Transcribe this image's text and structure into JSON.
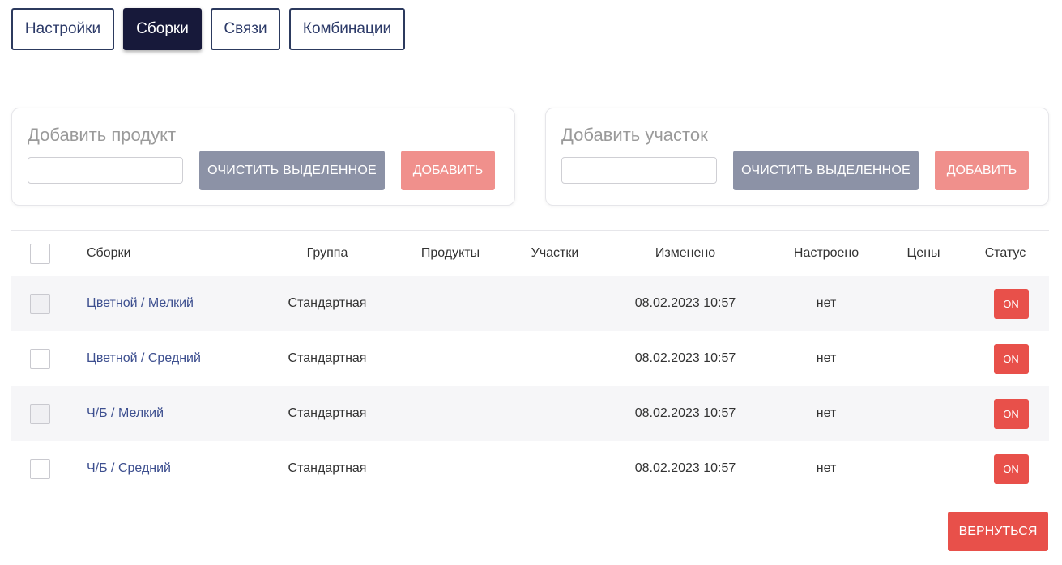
{
  "tabs": {
    "settings": "Настройки",
    "assemblies": "Сборки",
    "links": "Связи",
    "combinations": "Комбинации"
  },
  "add_product": {
    "title": "Добавить продукт",
    "input_value": "",
    "clear_label": "ОЧИСТИТЬ ВЫДЕЛЕННОЕ",
    "add_label": "ДОБАВИТЬ"
  },
  "add_area": {
    "title": "Добавить участок",
    "input_value": "",
    "clear_label": "ОЧИСТИТЬ ВЫДЕЛЕННОЕ",
    "add_label": "ДОБАВИТЬ"
  },
  "table": {
    "columns": [
      "Сборки",
      "Группа",
      "Продукты",
      "Участки",
      "Изменено",
      "Настроено",
      "Цены",
      "Статус"
    ],
    "rows": [
      {
        "name": "Цветной / Мелкий",
        "group": "Стандартная",
        "products": "",
        "areas": "",
        "modified": "08.02.2023 10:57",
        "configured": "нет",
        "prices": "",
        "status": "ON"
      },
      {
        "name": "Цветной / Средний",
        "group": "Стандартная",
        "products": "",
        "areas": "",
        "modified": "08.02.2023 10:57",
        "configured": "нет",
        "prices": "",
        "status": "ON"
      },
      {
        "name": "Ч/Б / Мелкий",
        "group": "Стандартная",
        "products": "",
        "areas": "",
        "modified": "08.02.2023 10:57",
        "configured": "нет",
        "prices": "",
        "status": "ON"
      },
      {
        "name": "Ч/Б / Средний",
        "group": "Стандартная",
        "products": "",
        "areas": "",
        "modified": "08.02.2023 10:57",
        "configured": "нет",
        "prices": "",
        "status": "ON"
      }
    ]
  },
  "back_label": "ВЕРНУТЬСЯ",
  "colors": {
    "active_tab": "#17193a",
    "accent_red": "#e8504a",
    "muted_red": "#f0908c",
    "gray_button": "#8c92a6",
    "link": "#3d4f8f"
  }
}
